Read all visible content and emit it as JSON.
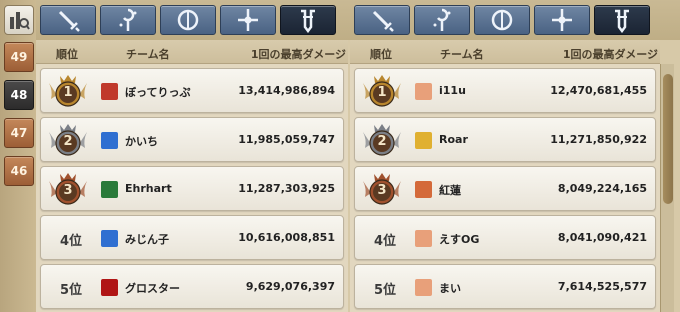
{
  "sidebar": {
    "filter_icon": "ranking-filter-icon",
    "seasons": [
      {
        "label": "49",
        "active": false
      },
      {
        "label": "48",
        "active": true
      },
      {
        "label": "47",
        "active": false
      },
      {
        "label": "46",
        "active": false
      }
    ]
  },
  "tabs": [
    {
      "icon": "sword-icon",
      "active": false
    },
    {
      "icon": "magic-staff-icon",
      "active": false
    },
    {
      "icon": "bow-icon",
      "active": false
    },
    {
      "icon": "cross-staff-icon",
      "active": false
    },
    {
      "icon": "shield-icon",
      "active": true
    }
  ],
  "columns": {
    "rank": "順位",
    "team": "チーム名",
    "damage": "1回の最高ダメージ"
  },
  "left_table": [
    {
      "rank": "1",
      "medal": "gold",
      "name": "ぼってりっぷ",
      "damage": "13,414,986,894",
      "icon": "dragon-emblem-icon",
      "icon_color": "#c0392b"
    },
    {
      "rank": "2",
      "medal": "silver",
      "name": "かいち",
      "damage": "11,985,059,747",
      "icon": "blue-wing-emblem-icon",
      "icon_color": "#2f6fd1"
    },
    {
      "rank": "3",
      "medal": "bronze",
      "name": "Ehrhart",
      "damage": "11,287,303,925",
      "icon": "star-map-emblem-icon",
      "icon_color": "#2a7a3a"
    },
    {
      "rank": "4位",
      "medal": "none",
      "name": "みじん子",
      "damage": "10,616,008,851",
      "icon": "blue-wing-emblem-icon",
      "icon_color": "#2f6fd1"
    },
    {
      "rank": "5位",
      "medal": "none",
      "name": "グロスター",
      "damage": "9,629,076,397",
      "icon": "re-logo-emblem-icon",
      "icon_color": "#b01515"
    }
  ],
  "right_table": [
    {
      "rank": "1",
      "medal": "gold",
      "name": "i11u",
      "damage": "12,470,681,455",
      "icon": "peach-shell-emblem-icon",
      "icon_color": "#e8a07a"
    },
    {
      "rank": "2",
      "medal": "silver",
      "name": "Roar",
      "damage": "11,271,850,922",
      "icon": "lion-face-emblem-icon",
      "icon_color": "#e0b030"
    },
    {
      "rank": "3",
      "medal": "bronze",
      "name": "紅蓮",
      "damage": "8,049,224,165",
      "icon": "cat-face-emblem-icon",
      "icon_color": "#d46a3a"
    },
    {
      "rank": "4位",
      "medal": "none",
      "name": "えすOG",
      "damage": "8,041,090,421",
      "icon": "peach-shell-emblem-icon",
      "icon_color": "#e8a07a"
    },
    {
      "rank": "5位",
      "medal": "none",
      "name": "まい",
      "damage": "7,614,525,577",
      "icon": "peach-shell-emblem-icon",
      "icon_color": "#e8a07a"
    }
  ],
  "colors": {
    "gold": "#b8862e",
    "silver": "#7b7f86",
    "bronze": "#a0512e",
    "tab_blue": "#4a6283",
    "tab_active": "#1b2433"
  }
}
